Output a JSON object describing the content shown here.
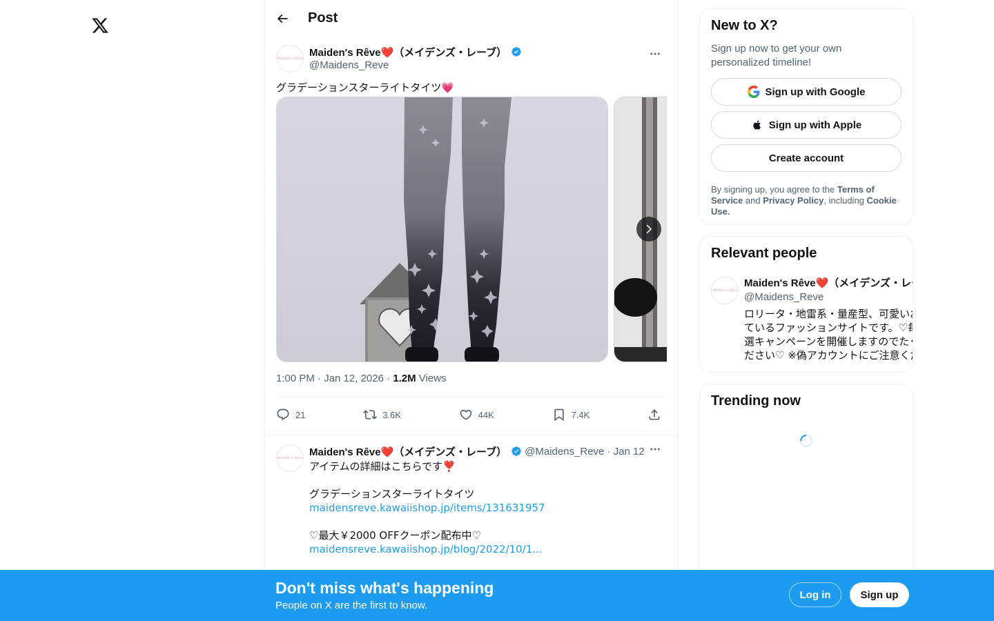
{
  "header": {
    "title": "Post"
  },
  "post": {
    "author_name": "Maiden's Rêve❤️（メイデンズ・レーブ）",
    "author_handle": "@Maidens_Reve",
    "avatar_text": "Maiden's Rêve",
    "text": "グラデーションスターライトタイツ💗",
    "time": "1:00 PM · Jan 12, 2026 · ",
    "views_count": "1.2M",
    "views_label": " Views",
    "actions": {
      "replies": "21",
      "reposts": "3.6K",
      "likes": "44K",
      "bookmarks": "7.4K"
    }
  },
  "reply": {
    "author_name": "Maiden's Rêve❤️（メイデンズ・レーブ）",
    "meta": "@Maidens_Reve · Jan 12",
    "line1": "アイテムの詳細はこちらです❣️",
    "line2": "グラデーションスターライトタイツ",
    "link1": "maidensreve.kawaiishop.jp/items/131631957",
    "line3": "♡最大￥2000 OFFクーポン配布中♡",
    "link2": "maidensreve.kawaiishop.jp/blog/2022/10/1..."
  },
  "signup_card": {
    "title": "New to X?",
    "subtitle": "Sign up now to get your own personalized timeline!",
    "google_label": "Sign up with Google",
    "apple_label": "Sign up with Apple",
    "create_label": "Create account",
    "legal_1": "By signing up, you agree to the ",
    "legal_terms": "Terms of Service",
    "legal_2": " and ",
    "legal_privacy": "Privacy Policy",
    "legal_3": ", including ",
    "legal_cookie": "Cookie Use."
  },
  "relevant_people": {
    "title": "Relevant people",
    "name": "Maiden's Rêve❤️（メイデンズ・レーブ）",
    "handle": "@Maidens_Reve",
    "bio_lines": [
      "ロリータ・地雷系・量産型、可愛いお洋服を取り扱っ",
      "ているファッションサイトです。♡毎月フォロワー様限定の抽",
      "選キャンペーンを開催しますのでたくさんご参加く",
      "ださい♡ ※偽アカウントにご注意ください"
    ]
  },
  "trending": {
    "title": "Trending now"
  },
  "banner": {
    "title": "Don't miss what's happening",
    "subtitle": "People on X are the first to know.",
    "login_label": "Log in",
    "signup_label": "Sign up"
  },
  "colors": {
    "accent": "#1d9bf0",
    "text": "#0f1419",
    "muted": "#536471"
  }
}
